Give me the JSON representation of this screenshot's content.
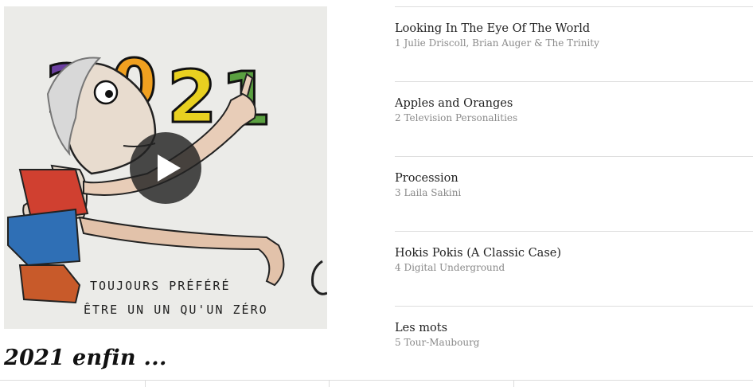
{
  "cover": {
    "year_digits": [
      "2",
      "0",
      "2",
      "1"
    ],
    "caption_lines": [
      "TOUJOURS PRÉFÉRÉ",
      "ÊTRE UN UN QU'UN ZÉRO"
    ],
    "play_icon": "play-icon"
  },
  "page": {
    "title": "2021 enfin ..."
  },
  "playlist": {
    "tracks": [
      {
        "title": "Looking In The Eye Of The World",
        "meta": "1 Julie Driscoll, Brian Auger & The Trinity"
      },
      {
        "title": "Apples and Oranges",
        "meta": "2 Television Personalities"
      },
      {
        "title": "Procession",
        "meta": "3 Laila Sakini"
      },
      {
        "title": "Hokis Pokis (A Classic Case)",
        "meta": "4 Digital Underground"
      },
      {
        "title": "Les mots",
        "meta": "5 Tour-Maubourg"
      }
    ]
  },
  "colors": {
    "digit_2a": "#6b3fa0",
    "digit_0": "#f0a020",
    "digit_2b": "#e8d020",
    "digit_1": "#5aa040",
    "play_button": "#222222"
  }
}
